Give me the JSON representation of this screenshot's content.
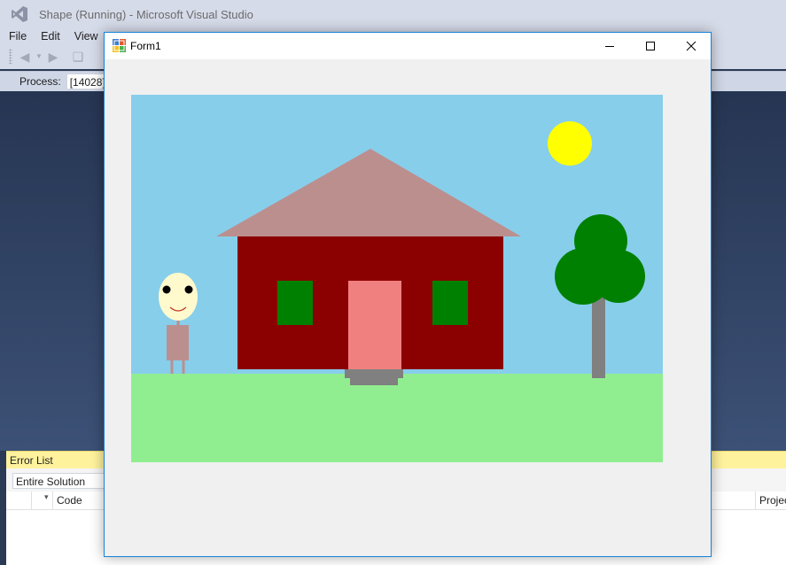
{
  "vs": {
    "title": "Shape (Running) - Microsoft Visual Studio",
    "menu": [
      "File",
      "Edit",
      "View"
    ],
    "process_label": "Process:",
    "process_value": "[14028]",
    "error_list": {
      "title": "Error List",
      "filter_value": "Entire Solution",
      "columns": {
        "code": "Code",
        "project": "Projec"
      }
    }
  },
  "form": {
    "title": "Form1",
    "controls": {
      "minimize": "minimize-icon",
      "maximize": "maximize-icon",
      "close": "close-icon"
    }
  },
  "scene": {
    "colors": {
      "sky": "#87ceeb",
      "grass": "#90ee90",
      "sun": "#ffff00",
      "roof": "#bc8f8f",
      "house": "#8b0000",
      "windows": "#008000",
      "door": "#f08080",
      "steps": "#808080",
      "tree_crown": "#008000",
      "tree_trunk": "#808080",
      "face": "#fffacd",
      "body": "#bc8f8f"
    }
  }
}
